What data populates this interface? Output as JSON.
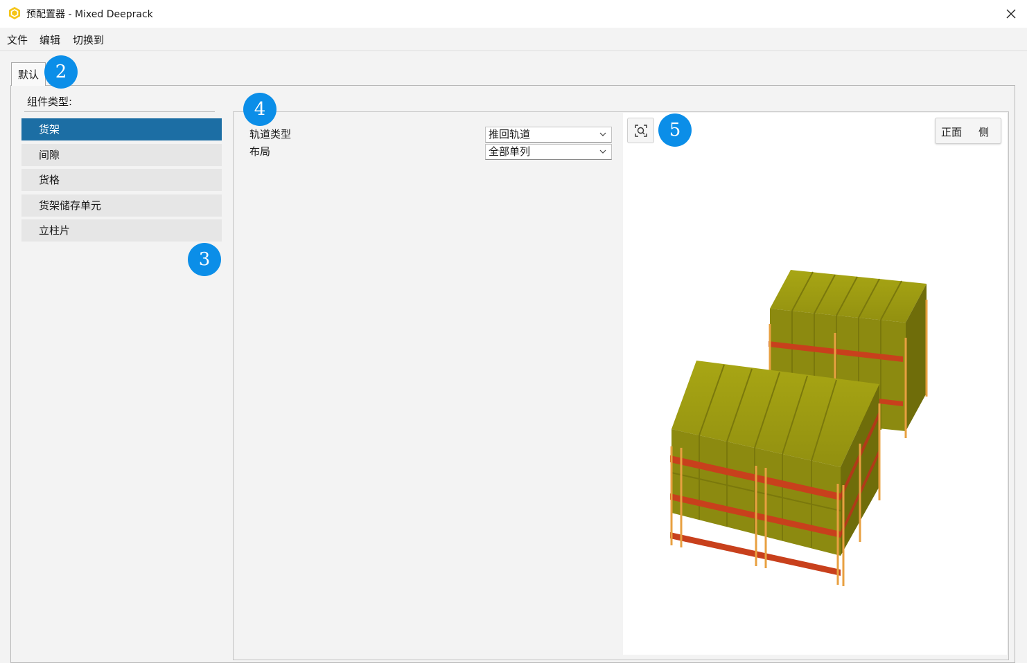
{
  "window": {
    "title": "预配置器 - Mixed Deeprack",
    "close_glyph": "✕",
    "icon": "app-logo-icon",
    "accent_color": "#1c6ea4"
  },
  "menu": {
    "items": [
      "文件",
      "编辑",
      "切换到"
    ]
  },
  "tabs": [
    {
      "label": "默认",
      "active": true
    }
  ],
  "component_types": {
    "title": "组件类型:",
    "items": [
      {
        "label": "货架",
        "selected": true
      },
      {
        "label": "间隙",
        "selected": false
      },
      {
        "label": "货格",
        "selected": false
      },
      {
        "label": "货架储存单元",
        "selected": false
      },
      {
        "label": "立柱片",
        "selected": false
      }
    ]
  },
  "properties": [
    {
      "label": "轨道类型",
      "value": "推回轨道"
    },
    {
      "label": "布局",
      "value": "全部单列"
    }
  ],
  "viewport": {
    "zoom_icon": "zoom-fit-icon",
    "view_buttons": {
      "front": "正面",
      "side": "侧"
    },
    "scene": "3d-pallet-rack-preview",
    "colors": {
      "cargo": "#9a9a10",
      "beam": "#c8401c",
      "upright": "#e8a040"
    }
  },
  "callouts": [
    "2",
    "3",
    "4",
    "5"
  ]
}
